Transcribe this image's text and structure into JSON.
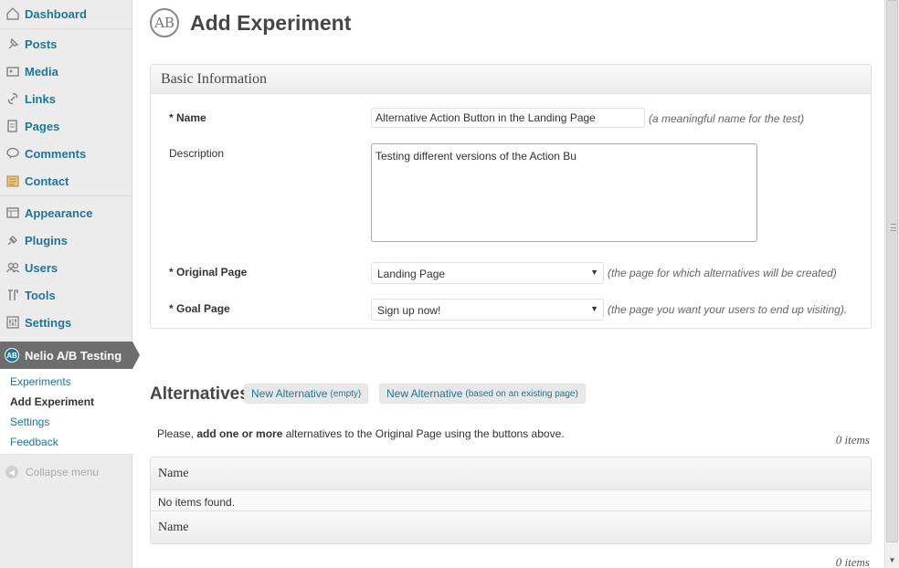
{
  "sidebar": {
    "items": [
      {
        "label": "Dashboard",
        "icon": "dashboard-icon"
      },
      {
        "label": "Posts",
        "icon": "pin-icon"
      },
      {
        "label": "Media",
        "icon": "media-icon"
      },
      {
        "label": "Links",
        "icon": "link-icon"
      },
      {
        "label": "Pages",
        "icon": "pages-icon"
      },
      {
        "label": "Comments",
        "icon": "comment-icon"
      },
      {
        "label": "Contact",
        "icon": "contact-icon"
      },
      {
        "label": "Appearance",
        "icon": "appearance-icon"
      },
      {
        "label": "Plugins",
        "icon": "plugin-icon"
      },
      {
        "label": "Users",
        "icon": "users-icon"
      },
      {
        "label": "Tools",
        "icon": "tools-icon"
      },
      {
        "label": "Settings",
        "icon": "settings-icon"
      }
    ],
    "active": {
      "label": "Nelio A/B Testing",
      "icon": "nelio-logo-icon"
    },
    "submenu": [
      "Experiments",
      "Add Experiment",
      "Settings",
      "Feedback"
    ],
    "collapse_label": "Collapse menu"
  },
  "page": {
    "title": "Add Experiment",
    "logo_text": "AB"
  },
  "basic_info": {
    "header": "Basic Information",
    "name_label": "* Name",
    "name_value": "Alternative Action Button in the Landing Page",
    "name_hint": "(a meaningful name for the test)",
    "description_label": "Description",
    "description_value": "Testing different versions of the Action Bu",
    "original_label": "* Original Page",
    "original_value": "Landing Page",
    "original_hint": "(the page for which alternatives will be created)",
    "goal_label": "* Goal Page",
    "goal_value": "Sign up now!",
    "goal_hint": "(the page you want your users to end up visiting)."
  },
  "alternatives": {
    "title": "Alternatives",
    "btn_empty_label": "New Alternative",
    "btn_empty_small": "(empty)",
    "btn_existing_label": "New Alternative",
    "btn_existing_small": "(based on an existing page)",
    "notice_prefix": "Please, ",
    "notice_bold": "add one or more",
    "notice_suffix": " alternatives to the Original Page using the buttons above.",
    "items_count_top": "0 items",
    "items_count_bottom": "0 items",
    "table_header": "Name",
    "table_footer": "Name",
    "empty_text": "No items found."
  },
  "colors": {
    "link": "#21759b",
    "active_menu": "#6d6d6d"
  }
}
